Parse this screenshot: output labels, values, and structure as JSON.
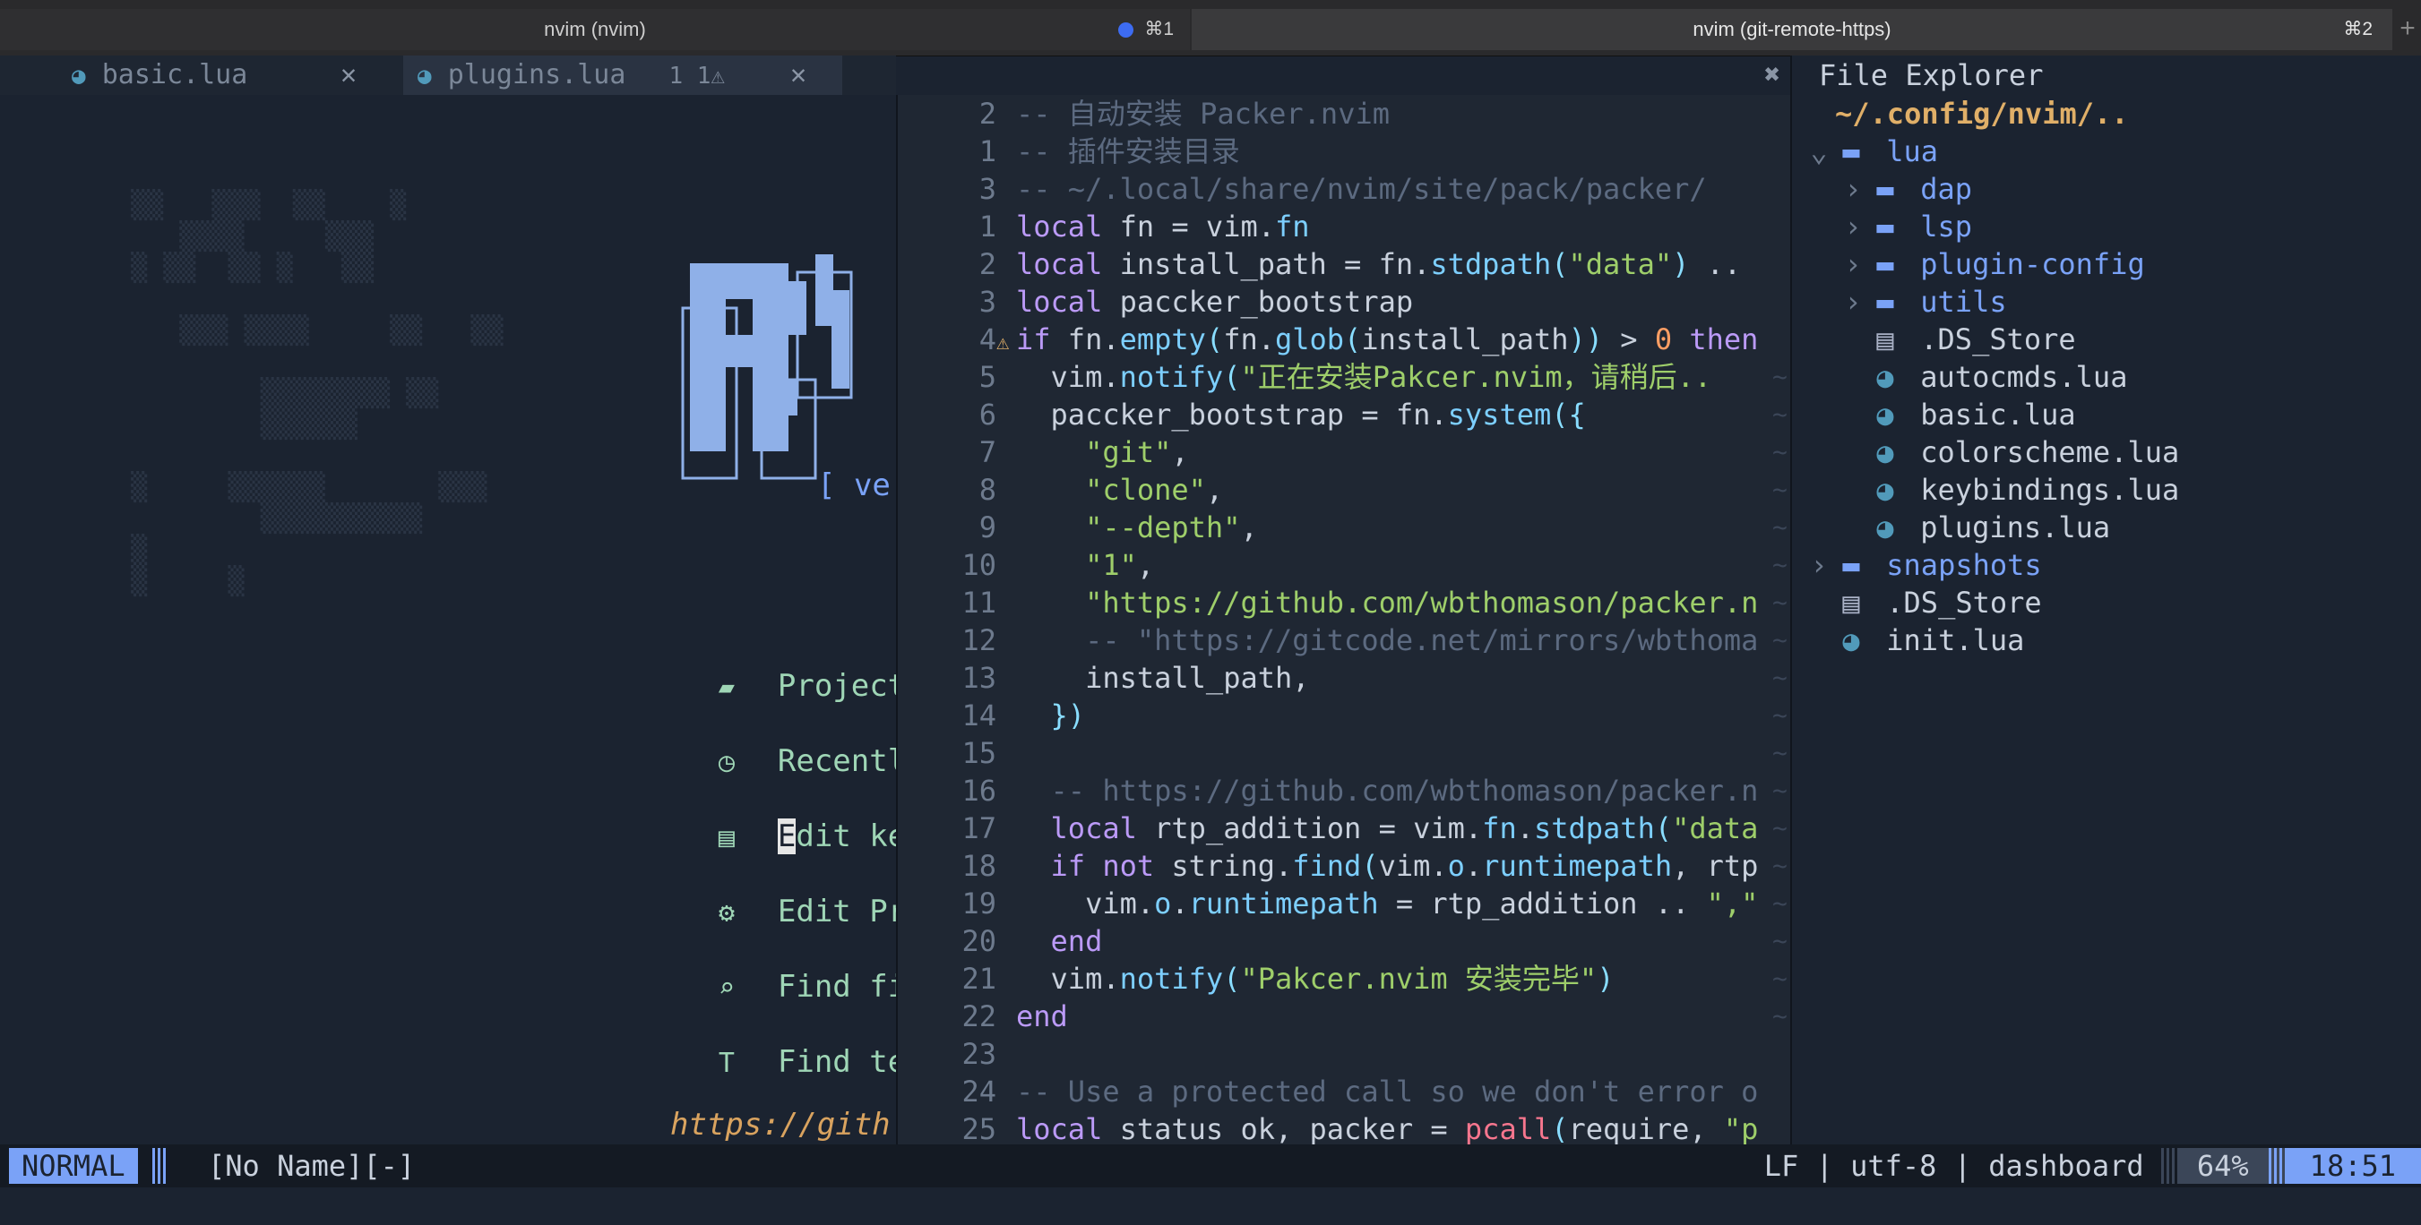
{
  "window": {
    "tabs": [
      {
        "title": "nvim (nvim)",
        "shortcut": "⌘1"
      },
      {
        "title": "nvim (git-remote-https)",
        "shortcut": "⌘2"
      }
    ],
    "new_tab_glyph": "+"
  },
  "bufferline": {
    "tabs": [
      {
        "icon": "lua-file-icon",
        "label": "basic.lua",
        "close": "✕"
      },
      {
        "icon": "lua-file-icon",
        "label": "plugins.lua",
        "badge": "1 1⚠",
        "close": "✕"
      }
    ],
    "split_close": "✖"
  },
  "dashboard": {
    "version": "[ ve",
    "items": [
      {
        "icon": "bookmark-icon",
        "glyph": "▰",
        "label": "Projects"
      },
      {
        "icon": "clock-icon",
        "glyph": "◷",
        "label": "Recently f"
      },
      {
        "icon": "keyboard-icon",
        "glyph": "▤",
        "label": "dit keybi",
        "cursor_char": "E"
      },
      {
        "icon": "gear-icon",
        "glyph": "⚙",
        "label": "Edit Proje"
      },
      {
        "icon": "search-file-icon",
        "glyph": "⌕",
        "label": "Find file"
      },
      {
        "icon": "text-icon",
        "glyph": "T",
        "label": "Find text"
      }
    ],
    "footer": "https://gith"
  },
  "code": {
    "lines": [
      {
        "n": "2",
        "sign": "",
        "segs": [
          [
            "cm",
            "-- 自动安装 Packer.nvim"
          ]
        ]
      },
      {
        "n": "1",
        "sign": "",
        "segs": [
          [
            "cm",
            "-- 插件安装目录"
          ]
        ]
      },
      {
        "n": "3",
        "sign": "",
        "segs": [
          [
            "cm",
            "-- ~/.local/share/nvim/site/pack/packer/"
          ]
        ]
      },
      {
        "n": "1",
        "sign": "",
        "segs": [
          [
            "kw",
            "local"
          ],
          [
            "id",
            " fn = vim."
          ],
          [
            "fn",
            "fn"
          ]
        ]
      },
      {
        "n": "2",
        "sign": "",
        "segs": [
          [
            "kw",
            "local"
          ],
          [
            "id",
            " install_path = fn."
          ],
          [
            "fn",
            "stdpath"
          ],
          [
            "op",
            "("
          ],
          [
            "str",
            "\"data\""
          ],
          [
            "op",
            ")"
          ],
          [
            "id",
            " .."
          ]
        ]
      },
      {
        "n": "3",
        "sign": "",
        "segs": [
          [
            "kw",
            "local"
          ],
          [
            "id",
            " paccker_bootstrap"
          ]
        ]
      },
      {
        "n": "4",
        "sign": "⚠",
        "segs": [
          [
            "kw",
            "if"
          ],
          [
            "id",
            " fn."
          ],
          [
            "fn",
            "empty"
          ],
          [
            "op",
            "("
          ],
          [
            "id",
            "fn."
          ],
          [
            "fn",
            "glob"
          ],
          [
            "op",
            "("
          ],
          [
            "id",
            "install_path"
          ],
          [
            "op",
            "))"
          ],
          [
            "id",
            " > "
          ],
          [
            "num",
            "0"
          ],
          [
            "kw",
            " then"
          ]
        ]
      },
      {
        "n": "5",
        "sign": "",
        "segs": [
          [
            "id",
            "  vim."
          ],
          [
            "fn",
            "notify"
          ],
          [
            "op",
            "("
          ],
          [
            "str",
            "\"正在安装Pakcer.nvim，请稍后.."
          ]
        ]
      },
      {
        "n": "6",
        "sign": "",
        "segs": [
          [
            "id",
            "  paccker_bootstrap = fn."
          ],
          [
            "fn",
            "system"
          ],
          [
            "op",
            "({"
          ]
        ]
      },
      {
        "n": "7",
        "sign": "",
        "segs": [
          [
            "str",
            "    \"git\""
          ],
          [
            "id",
            ","
          ]
        ]
      },
      {
        "n": "8",
        "sign": "",
        "segs": [
          [
            "str",
            "    \"clone\""
          ],
          [
            "id",
            ","
          ]
        ]
      },
      {
        "n": "9",
        "sign": "",
        "segs": [
          [
            "str",
            "    \"--depth\""
          ],
          [
            "id",
            ","
          ]
        ]
      },
      {
        "n": "10",
        "sign": "",
        "segs": [
          [
            "str",
            "    \"1\""
          ],
          [
            "id",
            ","
          ]
        ]
      },
      {
        "n": "11",
        "sign": "",
        "segs": [
          [
            "str",
            "    \"https://github.com/wbthomason/packer.n"
          ]
        ]
      },
      {
        "n": "12",
        "sign": "",
        "segs": [
          [
            "cm",
            "    -- \"https://gitcode.net/mirrors/wbthoma"
          ]
        ]
      },
      {
        "n": "13",
        "sign": "",
        "segs": [
          [
            "id",
            "    install_path,"
          ]
        ]
      },
      {
        "n": "14",
        "sign": "",
        "segs": [
          [
            "op",
            "  })"
          ]
        ]
      },
      {
        "n": "15",
        "sign": "",
        "segs": []
      },
      {
        "n": "16",
        "sign": "",
        "segs": [
          [
            "cm",
            "  -- https://github.com/wbthomason/packer.n"
          ]
        ]
      },
      {
        "n": "17",
        "sign": "",
        "segs": [
          [
            "kw",
            "  local"
          ],
          [
            "id",
            " rtp_addition = vim."
          ],
          [
            "fn",
            "fn"
          ],
          [
            "id",
            "."
          ],
          [
            "fn",
            "stdpath"
          ],
          [
            "op",
            "("
          ],
          [
            "str",
            "\"data"
          ]
        ]
      },
      {
        "n": "18",
        "sign": "",
        "segs": [
          [
            "kw",
            "  if not"
          ],
          [
            "id",
            " string."
          ],
          [
            "fn",
            "find"
          ],
          [
            "op",
            "("
          ],
          [
            "id",
            "vim."
          ],
          [
            "fn",
            "o"
          ],
          [
            "id",
            "."
          ],
          [
            "fn",
            "runtimepath"
          ],
          [
            "id",
            ", rtp"
          ]
        ]
      },
      {
        "n": "19",
        "sign": "",
        "segs": [
          [
            "id",
            "    vim."
          ],
          [
            "fn",
            "o"
          ],
          [
            "id",
            "."
          ],
          [
            "fn",
            "runtimepath"
          ],
          [
            "id",
            " = rtp_addition .. "
          ],
          [
            "str",
            "\",\""
          ]
        ]
      },
      {
        "n": "20",
        "sign": "",
        "segs": [
          [
            "kw",
            "  end"
          ]
        ]
      },
      {
        "n": "21",
        "sign": "",
        "segs": [
          [
            "id",
            "  vim."
          ],
          [
            "fn",
            "notify"
          ],
          [
            "op",
            "("
          ],
          [
            "str",
            "\"Pakcer.nvim 安装完毕\""
          ],
          [
            "op",
            ")"
          ]
        ]
      },
      {
        "n": "22",
        "sign": "",
        "segs": [
          [
            "kw",
            "end"
          ]
        ]
      },
      {
        "n": "23",
        "sign": "",
        "segs": []
      },
      {
        "n": "24",
        "sign": "",
        "segs": [
          [
            "cm",
            "-- Use a protected call so we don't error o"
          ]
        ]
      },
      {
        "n": "25",
        "sign": "",
        "segs": [
          [
            "kw",
            "local"
          ],
          [
            "id",
            " status_ok, packer = "
          ],
          [
            "call",
            "pcall"
          ],
          [
            "op",
            "("
          ],
          [
            "id",
            "require, "
          ],
          [
            "str",
            "\"p"
          ]
        ]
      }
    ],
    "overflow_mark": "~"
  },
  "explorer": {
    "title": "File Explorer",
    "path": "~/.config/nvim/..",
    "nodes": [
      {
        "kind": "folder",
        "depth": 1,
        "chev": "⌄",
        "label": "lua"
      },
      {
        "kind": "folder",
        "depth": 2,
        "chev": "›",
        "label": "dap"
      },
      {
        "kind": "folder",
        "depth": 2,
        "chev": "›",
        "label": "lsp"
      },
      {
        "kind": "folder",
        "depth": 2,
        "chev": "›",
        "label": "plugin-config"
      },
      {
        "kind": "folder",
        "depth": 2,
        "chev": "›",
        "label": "utils"
      },
      {
        "kind": "plainfile",
        "depth": 2,
        "chev": "",
        "label": ".DS_Store"
      },
      {
        "kind": "file",
        "depth": 2,
        "chev": "",
        "label": "autocmds.lua"
      },
      {
        "kind": "file",
        "depth": 2,
        "chev": "",
        "label": "basic.lua"
      },
      {
        "kind": "file",
        "depth": 2,
        "chev": "",
        "label": "colorscheme.lua"
      },
      {
        "kind": "file",
        "depth": 2,
        "chev": "",
        "label": "keybindings.lua"
      },
      {
        "kind": "file",
        "depth": 2,
        "chev": "",
        "label": "plugins.lua"
      },
      {
        "kind": "folder",
        "depth": 1,
        "chev": "›",
        "label": "snapshots"
      },
      {
        "kind": "plainfile",
        "depth": 1,
        "chev": "",
        "label": ".DS_Store"
      },
      {
        "kind": "file",
        "depth": 1,
        "chev": "",
        "label": "init.lua"
      }
    ]
  },
  "statusline": {
    "mode": "NORMAL",
    "filename": "[No Name][-]",
    "info": "LF | utf-8 | dashboard ",
    "percent": "64%",
    "time": "18:51"
  },
  "colors": {
    "background": "#1b2330",
    "accent": "#7aa2f7",
    "dashboard_green": "#9fd6b6",
    "path_orange": "#e0af68"
  }
}
